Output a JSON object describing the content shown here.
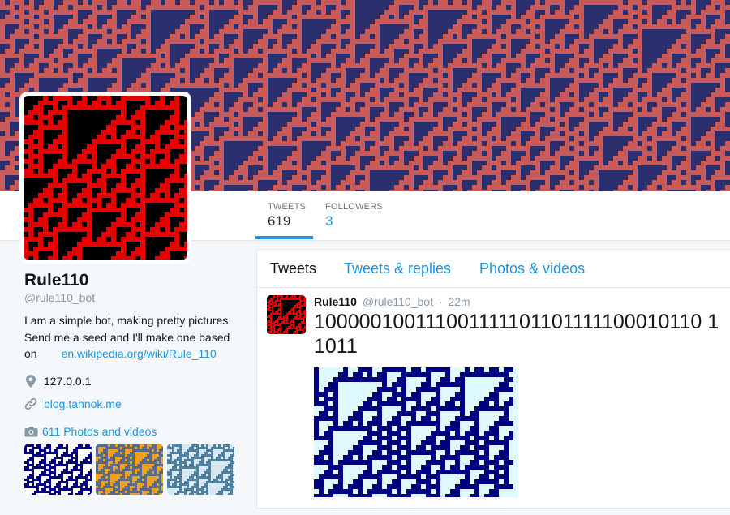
{
  "colors": {
    "banner_bg": "#2c2f6e",
    "banner_cells": "#c95a5a",
    "avatar_bg": "#000000",
    "avatar_cells": "#e60000",
    "accent": "#1b95e0",
    "tweet_image_bg": "#dffaff",
    "tweet_image_cells": "#000080"
  },
  "nav": {
    "tweets_label": "TWEETS",
    "tweets_count": "619",
    "followers_label": "FOLLOWERS",
    "followers_count": "3"
  },
  "profile": {
    "name": "Rule110",
    "handle": "@rule110_bot",
    "bio_line1": "I am a simple bot, making pretty pictures.",
    "bio_line2": "Send me a seed and I'll make one based",
    "bio_line3": "on",
    "bio_link": "en.wikipedia.org/wiki/Rule_110",
    "location": "127.0.0.1",
    "url": "blog.tahnok.me",
    "photos_link": "611 Photos and videos"
  },
  "tabs": [
    {
      "label": "Tweets"
    },
    {
      "label": "Tweets & replies"
    },
    {
      "label": "Photos & videos"
    }
  ],
  "tweet": {
    "name": "Rule110",
    "handle": "@rule110_bot",
    "dot": "·",
    "time": "22m",
    "text": "100000100111001111101101111100010110 11011",
    "seed_bits": "10000010011100111110110111110001011011011"
  },
  "icons": {
    "location": "map-pin-icon",
    "url": "link-icon",
    "photos": "camera-icon"
  },
  "thumbnails": [
    {
      "bg": "#ffffff",
      "fg": "#000080"
    },
    {
      "bg": "#f0a020",
      "fg": "#5a6a8a"
    },
    {
      "bg": "#d8e8f0",
      "fg": "#5080a0"
    }
  ]
}
